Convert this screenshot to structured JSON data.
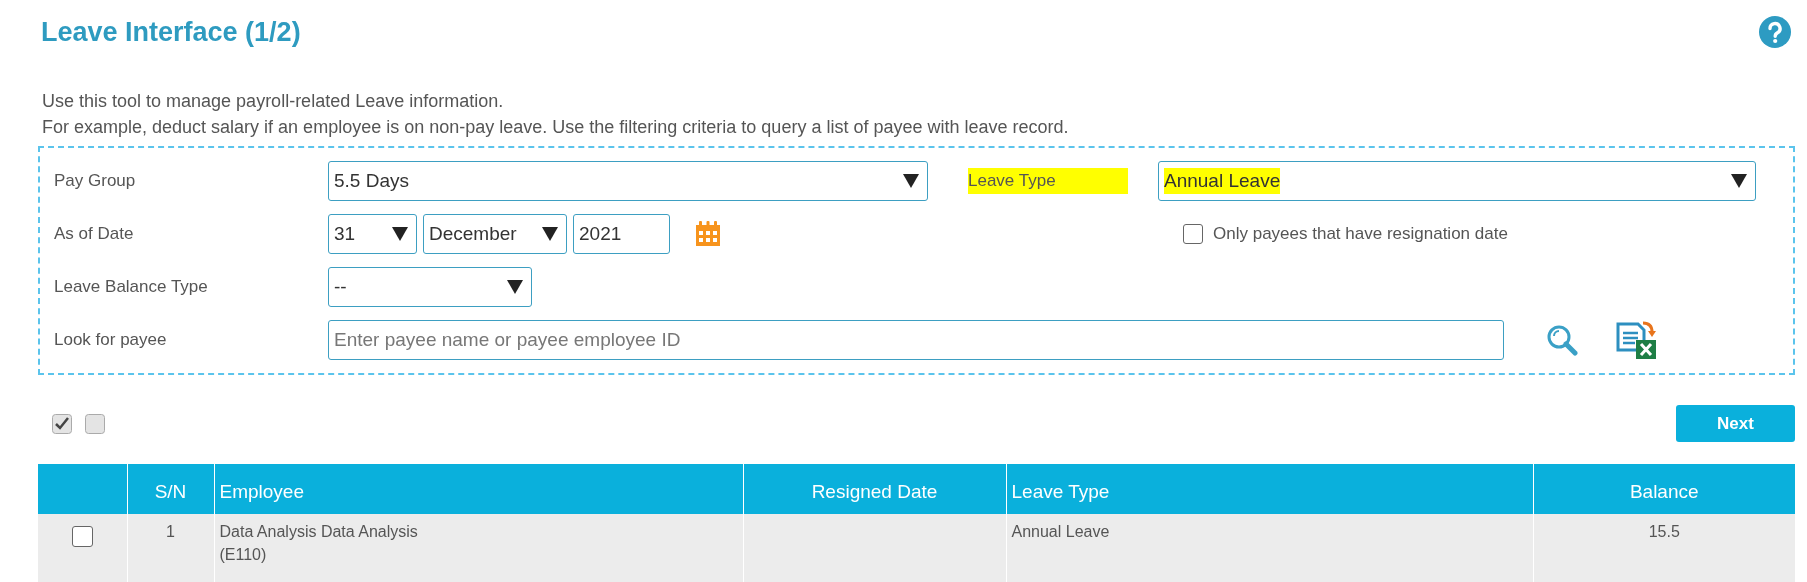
{
  "title": "Leave Interface (1/2)",
  "description": [
    "Use this tool to manage payroll-related Leave information.",
    "For example, deduct salary if an employee is on non-pay leave. Use the filtering criteria to query a list of payee with leave record."
  ],
  "filters": {
    "pay_group": {
      "label": "Pay Group",
      "value": "5.5 Days"
    },
    "leave_type": {
      "label": "Leave Type",
      "value": "Annual Leave",
      "highlighted": true
    },
    "as_of_date": {
      "label": "As of Date",
      "day": "31",
      "month": "December",
      "year": "2021"
    },
    "resignation_only": {
      "label": "Only payees that have resignation date",
      "checked": false
    },
    "leave_balance_type": {
      "label": "Leave Balance Type",
      "value": "--"
    },
    "payee_search": {
      "label": "Look for payee",
      "placeholder": "Enter payee name or payee employee ID"
    }
  },
  "next_button": "Next",
  "table": {
    "columns": [
      "S/N",
      "Employee",
      "Resigned Date",
      "Leave Type",
      "Balance"
    ],
    "rows": [
      {
        "selected": false,
        "sn": "1",
        "employee": "Data Analysis Data Analysis",
        "employee_id": "(E110)",
        "leave_type": "Annual Leave",
        "balance": "15.5"
      }
    ]
  }
}
